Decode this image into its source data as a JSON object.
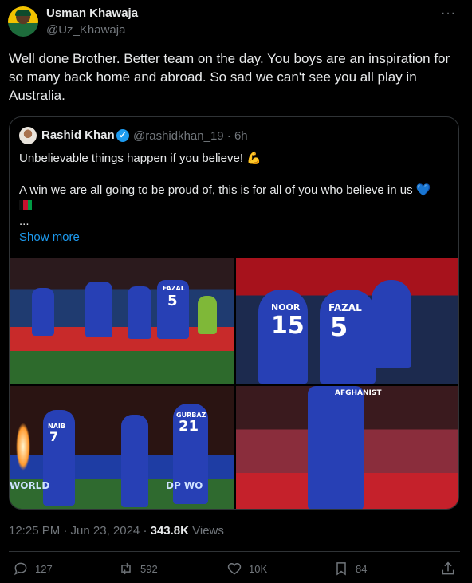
{
  "author": {
    "display_name": "Usman Khawaja",
    "handle": "@Uz_Khawaja",
    "more_label": "···"
  },
  "tweet": {
    "text": "Well done Brother. Better team on the day. You boys are an inspiration for so many back home and abroad. So sad we can't see you all play in Australia."
  },
  "quote": {
    "name": "Rashid Khan",
    "handle_time": "@rashidkhan_19 · 6h",
    "line1": "Unbelievable things happen if you believe! 💪",
    "line2": "A win we are all going to be proud of, this is for all of you who believe in us 💙",
    "ellipsis": "...",
    "show_more": "Show more",
    "photo_text": {
      "p1_fazal": "FAZAL",
      "p1_five": "5",
      "p2_noor": "NOOR",
      "p2_fifteen": "15",
      "p2_fazal": "FAZAL",
      "p2_five": "5",
      "p3_naib": "NAIB",
      "p3_seven": "7",
      "p3_gurbaz": "GURBAZ",
      "p3_twentyone": "21",
      "p3_world": "WORLD",
      "p3_dpw": "DP WO",
      "p4_afghanistan": "AFGHANIST"
    }
  },
  "meta": {
    "time_date": "12:25 PM · Jun 23, 2024 · ",
    "views_count": "343.8K",
    "views_label": " Views"
  },
  "actions": {
    "replies": "127",
    "reposts": "592",
    "likes": "10K",
    "bookmarks": "84"
  },
  "colors": {
    "background": "#000000",
    "text": "#e7e9ea",
    "secondary": "#71767b",
    "accent": "#1d9bf0",
    "border": "#2f3336"
  },
  "icons": [
    "more-icon",
    "verified-icon",
    "reply-icon",
    "repost-icon",
    "like-icon",
    "bookmark-icon",
    "share-icon"
  ]
}
